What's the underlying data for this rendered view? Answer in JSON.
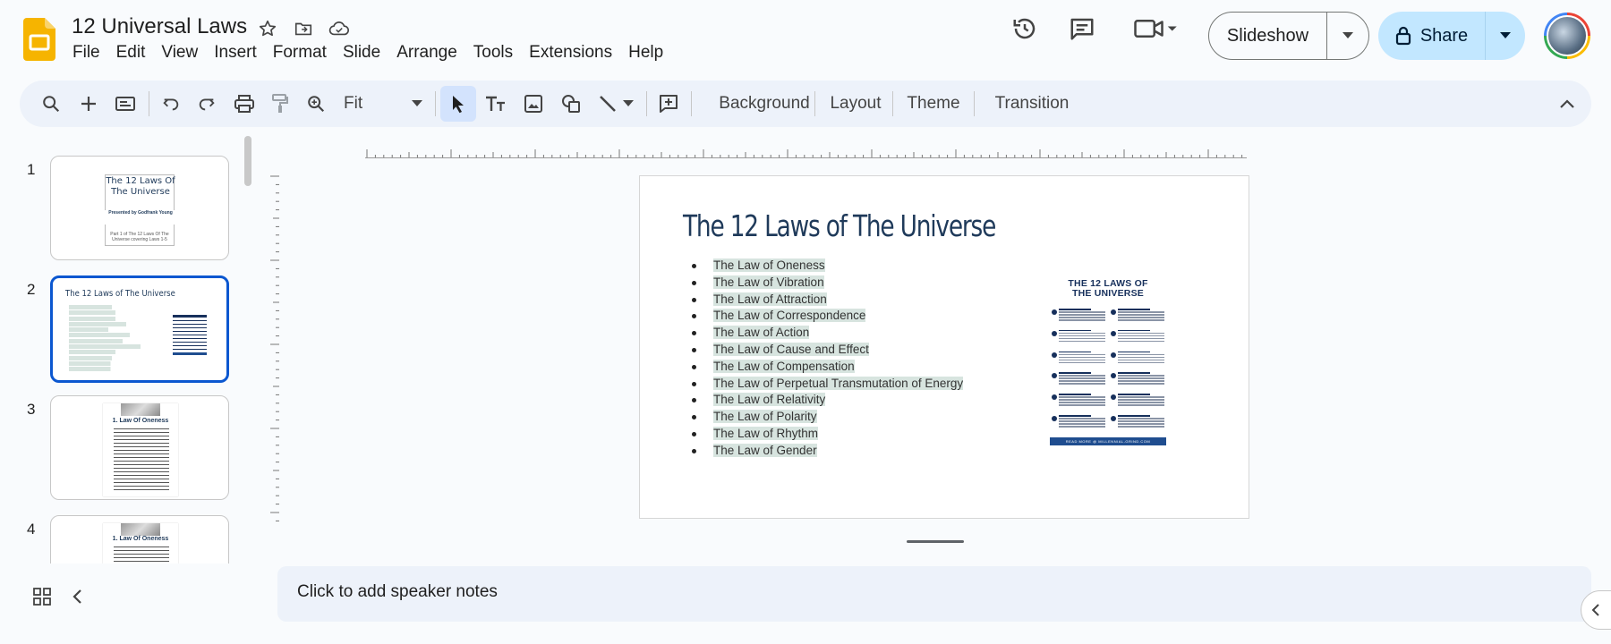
{
  "app": {
    "doc_title": "12 Universal Laws",
    "icons": [
      "star-icon",
      "move-to-folder-icon",
      "cloud-saved-icon"
    ]
  },
  "menu": [
    "File",
    "Edit",
    "View",
    "Insert",
    "Format",
    "Slide",
    "Arrange",
    "Tools",
    "Extensions",
    "Help"
  ],
  "header": {
    "slideshow_label": "Slideshow",
    "share_label": "Share"
  },
  "toolbar": {
    "zoom_value": "Fit",
    "background_label": "Background",
    "layout_label": "Layout",
    "theme_label": "Theme",
    "transition_label": "Transition"
  },
  "filmstrip": {
    "slides": [
      {
        "num": "1",
        "title": "The 12 Laws Of\nThe Universe",
        "sub": "Presented by Godfrank Young",
        "foot": "Part 1 of The 12 Laws Of The Universe covering Laws 1-5"
      },
      {
        "num": "2",
        "title": "The 12  Laws of The Universe"
      },
      {
        "num": "3",
        "title": "1. Law Of Oneness"
      },
      {
        "num": "4",
        "title": "1. Law Of Oneness"
      }
    ]
  },
  "slide": {
    "title": "The 12  Laws of The Universe",
    "bullets": [
      "The Law of Oneness",
      "The Law of Vibration",
      "The Law of Attraction",
      "The Law of Correspondence",
      "The Law of Action",
      "The Law of Cause and Effect",
      "The Law of Compensation",
      "The Law of Perpetual Transmutation of Energy",
      "The Law of Relativity",
      "The Law of Polarity",
      "The Law of Rhythm",
      "The Law of Gender"
    ],
    "poster": {
      "title": "THE 12 LAWS OF\nTHE UNIVERSE",
      "footer": "READ MORE @ MILLENNIAL-GRIND.COM"
    }
  },
  "notes": {
    "placeholder": "Click to add speaker notes"
  },
  "colors": {
    "accent": "#0b57d0",
    "share_bg": "#c2e7ff",
    "toolbar_bg": "#edf2fa",
    "text_highlight": "#d7e4df",
    "slide_title": "#1f3a5a"
  }
}
